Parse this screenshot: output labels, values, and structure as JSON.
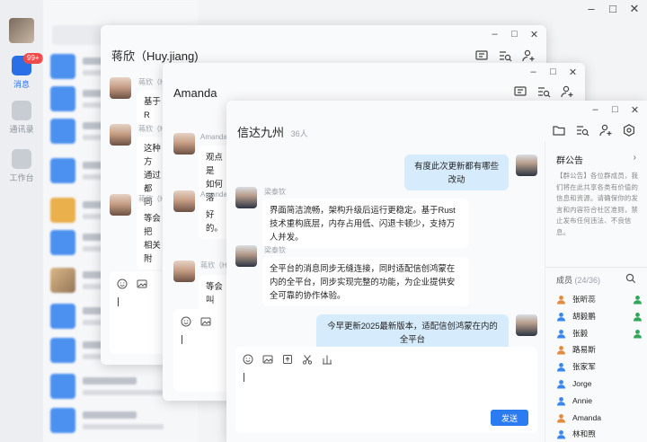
{
  "main": {
    "nav": [
      {
        "label": "消息",
        "badge": "99+"
      },
      {
        "label": "通讯录"
      },
      {
        "label": "工作台"
      }
    ]
  },
  "win1": {
    "title": "蒋欣（Huy.jiang)",
    "messages": [
      {
        "sender": "蒋欣（Hu",
        "text": "基于R"
      },
      {
        "sender": "蒋欣（Hu",
        "text": "这种方\n通过都\n同步。"
      },
      {
        "sender": "蒋欣（Hu",
        "text": "等会把\n相关附"
      }
    ]
  },
  "win2": {
    "title": "Amanda",
    "messages": [
      {
        "sender": "Amanda",
        "text": "观点是\n如何落"
      },
      {
        "sender": "Amanda",
        "text": "好的。"
      },
      {
        "sender": "蒋欣（Hu",
        "text": "等会叫"
      }
    ]
  },
  "win3": {
    "title": "信达九州",
    "count": "36人",
    "messages": [
      {
        "sender": "",
        "text": "有度此次更新都有哪些改动",
        "mine": true
      },
      {
        "sender": "梁泰钦",
        "text": "界面简洁流畅，架构升级后运行更稳定。基于Rust技术重构底层，内存占用低、闪退卡顿少，支持万人并发。"
      },
      {
        "sender": "梁泰钦",
        "text": "全平台的消息同步无缝连接，同时适配信创鸿蒙在内的全平台，同步实现完整的功能，为企业提供安全可靠的协作体验。"
      },
      {
        "sender": "",
        "text": "今早更新2025最新版本，适配信创鸿蒙在内的全平台",
        "mine": true
      }
    ],
    "send_label": "发送"
  },
  "panel": {
    "notice_title": "群公告",
    "notice_text": "【群公告】各位群成员，我们将在此共享各类有价值的信息和资源。请确保你的发言和内容符合社区准则，禁止发布任何违法、不良信息。",
    "members_label": "成员",
    "members_count": "(24/36)",
    "members": [
      {
        "name": "张昕蕊",
        "color": "#e58a3a",
        "role": "#2fa75a"
      },
      {
        "name": "胡毅鹏",
        "color": "#3a86f0",
        "role": "#2fa75a"
      },
      {
        "name": "张毅",
        "color": "#3a86f0",
        "role": "#2fa75a"
      },
      {
        "name": "路易斯",
        "color": "#e58a3a",
        "role": ""
      },
      {
        "name": "张家军",
        "color": "#3a86f0",
        "role": ""
      },
      {
        "name": "Jorge",
        "color": "#3a86f0",
        "role": ""
      },
      {
        "name": "Annie",
        "color": "#3a86f0",
        "role": ""
      },
      {
        "name": "Amanda",
        "color": "#e58a3a",
        "role": ""
      },
      {
        "name": "林和煦",
        "color": "#3a86f0",
        "role": ""
      }
    ]
  }
}
